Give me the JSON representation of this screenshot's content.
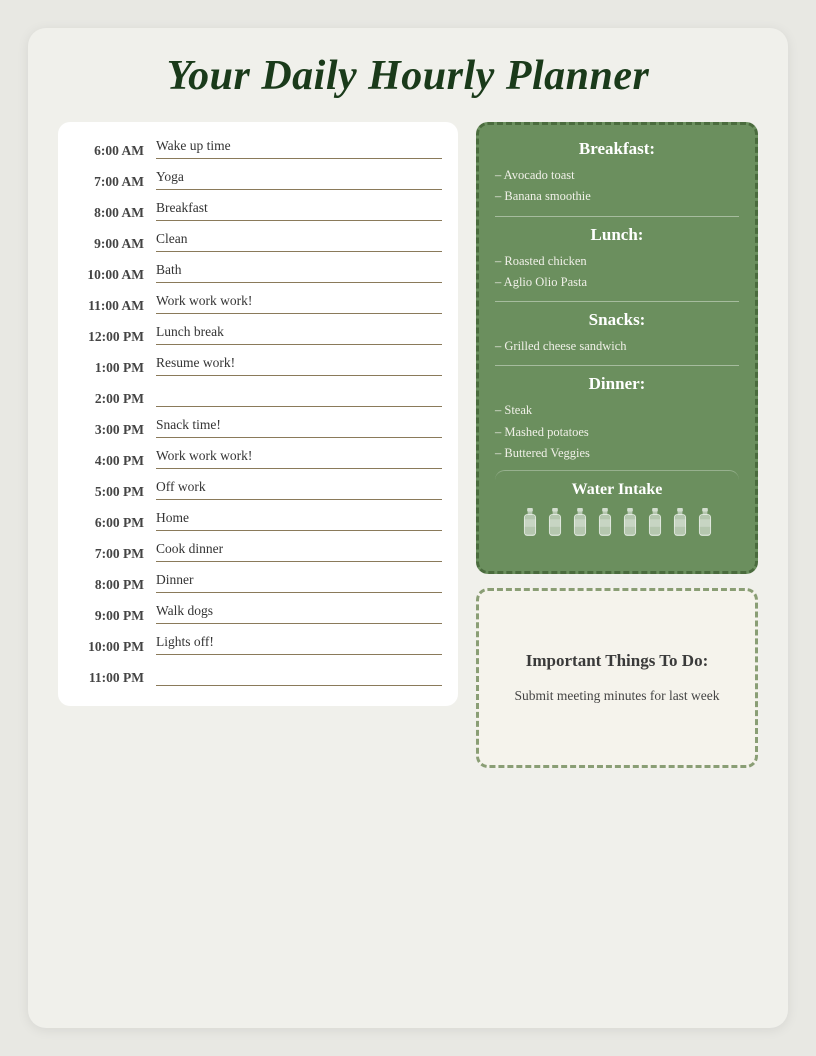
{
  "title": "Your Daily Hourly Planner",
  "schedule": [
    {
      "time": "6:00 AM",
      "task": "Wake up time"
    },
    {
      "time": "7:00 AM",
      "task": "Yoga"
    },
    {
      "time": "8:00 AM",
      "task": "Breakfast"
    },
    {
      "time": "9:00 AM",
      "task": "Clean"
    },
    {
      "time": "10:00 AM",
      "task": "Bath"
    },
    {
      "time": "11:00 AM",
      "task": "Work work work!"
    },
    {
      "time": "12:00 PM",
      "task": "Lunch break"
    },
    {
      "time": "1:00 PM",
      "task": "Resume work!"
    },
    {
      "time": "2:00 PM",
      "task": ""
    },
    {
      "time": "3:00 PM",
      "task": "Snack time!"
    },
    {
      "time": "4:00 PM",
      "task": "Work work work!"
    },
    {
      "time": "5:00 PM",
      "task": "Off work"
    },
    {
      "time": "6:00 PM",
      "task": "Home"
    },
    {
      "time": "7:00 PM",
      "task": "Cook dinner"
    },
    {
      "time": "8:00 PM",
      "task": "Dinner"
    },
    {
      "time": "9:00 PM",
      "task": "Walk dogs"
    },
    {
      "time": "10:00 PM",
      "task": "Lights off!"
    },
    {
      "time": "11:00 PM",
      "task": ""
    }
  ],
  "meals": {
    "breakfast_title": "Breakfast:",
    "breakfast_items": [
      "– Avocado toast",
      "– Banana smoothie"
    ],
    "lunch_title": "Lunch:",
    "lunch_items": [
      "– Roasted chicken",
      "– Aglio Olio Pasta"
    ],
    "snacks_title": "Snacks:",
    "snacks_items": [
      "– Grilled cheese sandwich"
    ],
    "dinner_title": "Dinner:",
    "dinner_items": [
      "– Steak",
      "– Mashed potatoes",
      "– Buttered Veggies"
    ]
  },
  "water": {
    "title": "Water Intake",
    "bottle_count": 8
  },
  "important": {
    "title": "Important Things To Do:",
    "text": "Submit meeting minutes for last week"
  }
}
